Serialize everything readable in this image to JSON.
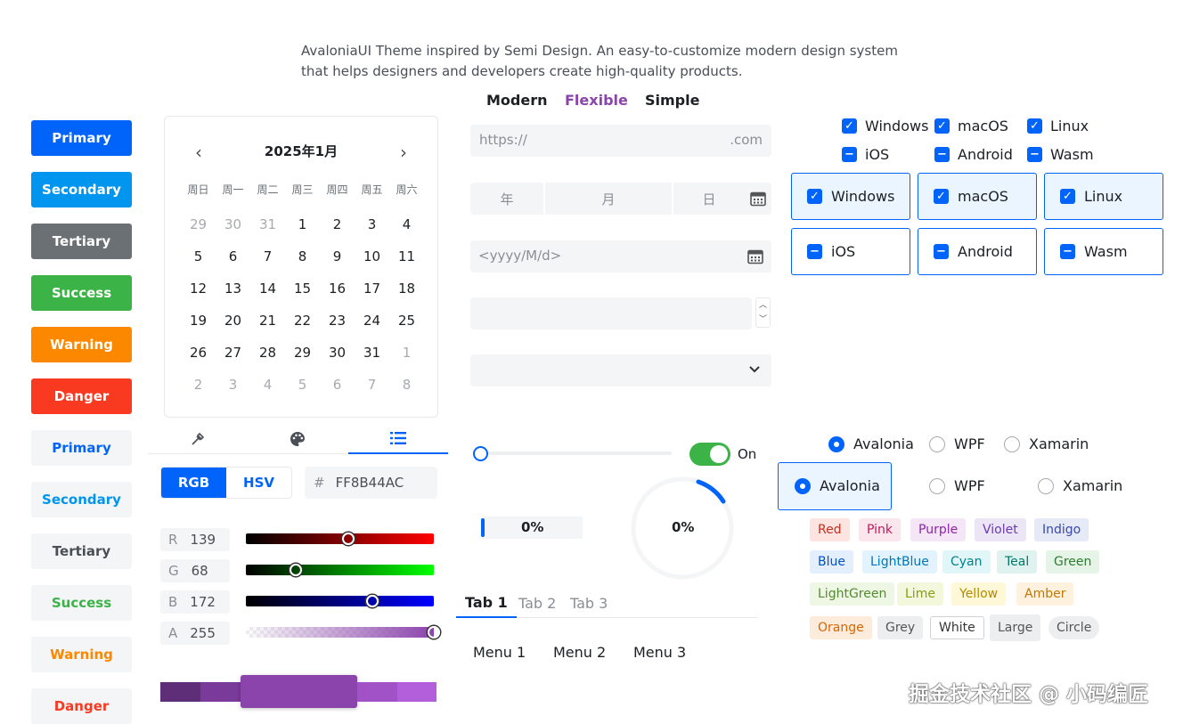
{
  "tagline": "AvaloniaUI Theme inspired by Semi Design. An easy-to-customize modern design system that helps designers and developers create high-quality products.",
  "headings": {
    "modern": "Modern",
    "flexible": "Flexible",
    "simple": "Simple"
  },
  "solid_buttons": [
    "Primary",
    "Secondary",
    "Tertiary",
    "Success",
    "Warning",
    "Danger"
  ],
  "light_buttons": [
    "Primary",
    "Secondary",
    "Tertiary",
    "Success",
    "Warning",
    "Danger"
  ],
  "colors": {
    "primary": "#0064fa",
    "secondary": "#0095ee",
    "tertiary": "#6b7075",
    "success": "#3bb346",
    "warning": "#fc8800",
    "danger": "#f93920",
    "picked": "#8B44AC"
  },
  "calendar": {
    "month": "2025年1月",
    "weekdays": [
      "周日",
      "周一",
      "周二",
      "周三",
      "周四",
      "周五",
      "周六"
    ],
    "weeks": [
      [
        "29",
        "30",
        "31",
        "1",
        "2",
        "3",
        "4"
      ],
      [
        "5",
        "6",
        "7",
        "8",
        "9",
        "10",
        "11"
      ],
      [
        "12",
        "13",
        "14",
        "15",
        "16",
        "17",
        "18"
      ],
      [
        "19",
        "20",
        "21",
        "22",
        "23",
        "24",
        "25"
      ],
      [
        "26",
        "27",
        "28",
        "29",
        "30",
        "31",
        "1"
      ],
      [
        "2",
        "3",
        "4",
        "5",
        "6",
        "7",
        "8"
      ]
    ]
  },
  "color_picker": {
    "modes": [
      "RGB",
      "HSV"
    ],
    "hash": "#",
    "hex": "FF8B44AC",
    "channels": [
      {
        "key": "R",
        "value": "139"
      },
      {
        "key": "G",
        "value": "68"
      },
      {
        "key": "B",
        "value": "172"
      },
      {
        "key": "A",
        "value": "255"
      }
    ]
  },
  "inputs": {
    "url_prefix": "https://",
    "url_suffix": ".com",
    "date_parts": [
      "年",
      "月",
      "日"
    ],
    "date_placeholder": "<yyyy/M/d>"
  },
  "slider": {
    "value": 0
  },
  "toggle": {
    "label": "On",
    "checked": true
  },
  "progress": {
    "bar": "0%",
    "ring": "0%"
  },
  "tabs": [
    "Tab 1",
    "Tab 2",
    "Tab 3"
  ],
  "menus": [
    "Menu 1",
    "Menu 2",
    "Menu 3"
  ],
  "checkboxes": [
    "Windows",
    "macOS",
    "Linux",
    "iOS",
    "Android",
    "Wasm"
  ],
  "radios": [
    "Avalonia",
    "WPF",
    "Xamarin"
  ],
  "tags": [
    "Red",
    "Pink",
    "Purple",
    "Violet",
    "Indigo",
    "Blue",
    "LightBlue",
    "Cyan",
    "Teal",
    "Green",
    "LightGreen",
    "Lime",
    "Yellow",
    "Amber",
    "Orange",
    "Grey",
    "White",
    "Large",
    "Circle"
  ],
  "watermark": "掘金技术社区 @ 小码编匠"
}
